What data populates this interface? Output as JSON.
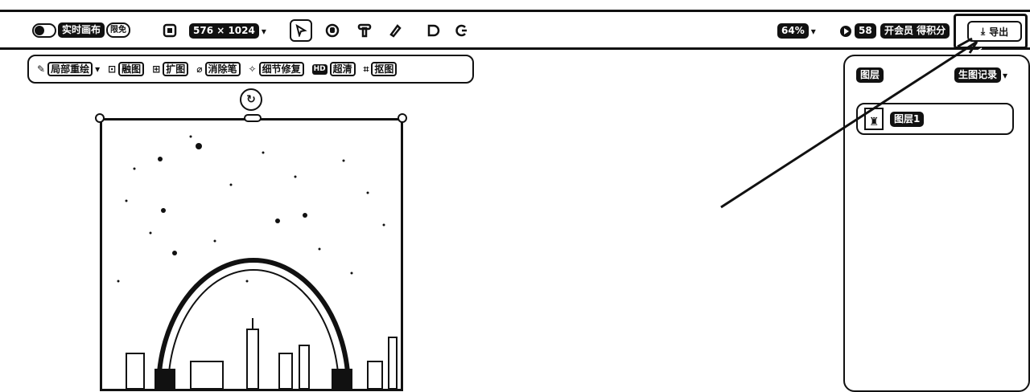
{
  "toolbar": {
    "realtime_label": "实时画布",
    "realtime_badge": "限免",
    "size_label": "576 × 1024",
    "zoom_label": "64%",
    "credits_label": "58",
    "member_label": "开会员 得积分",
    "export_label": "导出"
  },
  "edit_tools": [
    {
      "label": "局部重绘",
      "icon": "brush-icon"
    },
    {
      "label": "融图",
      "icon": "merge-icon"
    },
    {
      "label": "扩图",
      "icon": "expand-icon"
    },
    {
      "label": "消除笔",
      "icon": "eraser-icon"
    },
    {
      "label": "细节修复",
      "icon": "wand-icon"
    },
    {
      "label": "超清",
      "icon": "hd-icon",
      "badge": "HD"
    },
    {
      "label": "抠图",
      "icon": "cutout-icon"
    }
  ],
  "layers_panel": {
    "title": "图层",
    "history_label": "生图记录",
    "layer_name": "图层1"
  },
  "canvas": {
    "image_alt": "night sky with headphones over a city skyline"
  }
}
